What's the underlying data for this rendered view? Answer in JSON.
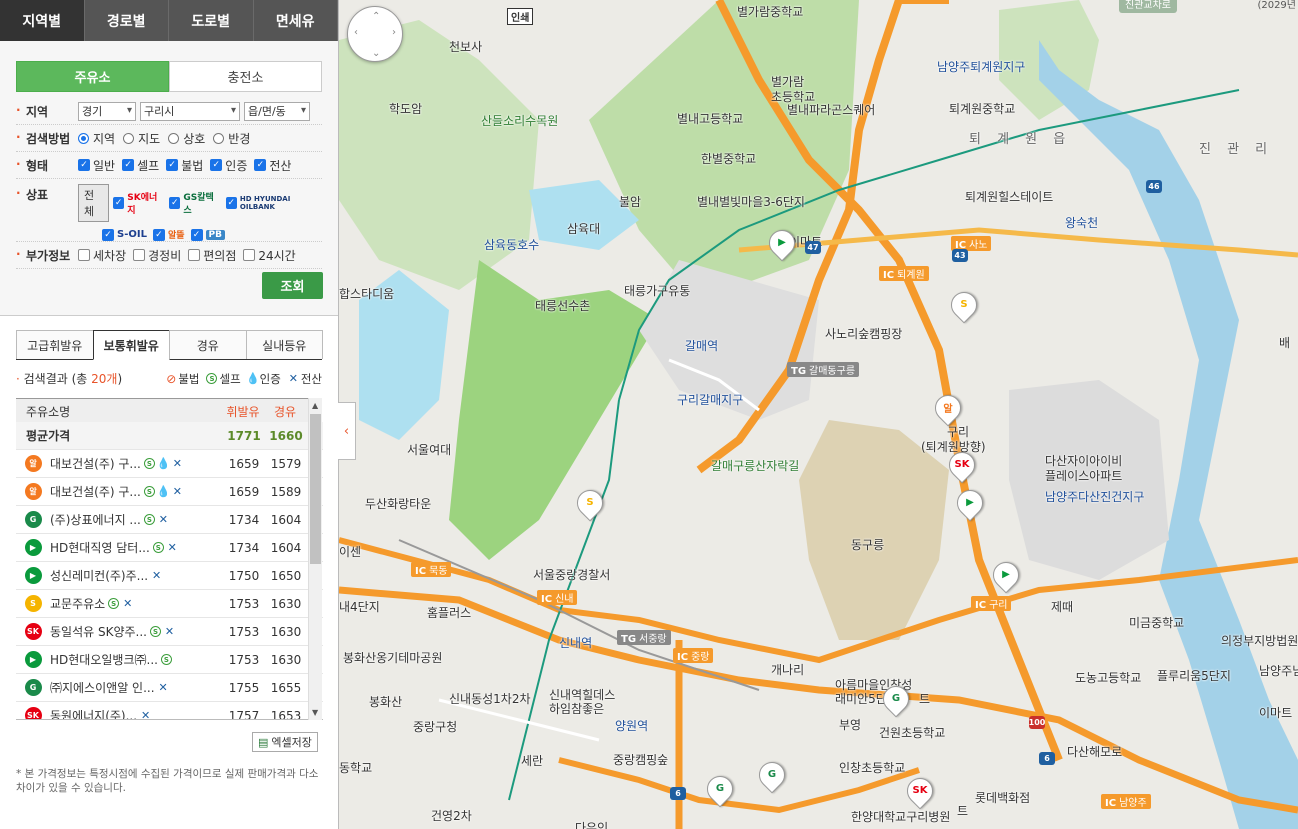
{
  "top_tabs": [
    "지역별",
    "경로별",
    "도로별",
    "면세유"
  ],
  "mode_tabs": [
    "주유소",
    "충전소"
  ],
  "filters": {
    "region_label": "지역",
    "region_sido": "경기",
    "region_sigungu": "구리시",
    "region_dong": "읍/면/동",
    "method_label": "검색방법",
    "methods": [
      "지역",
      "지도",
      "상호",
      "반경"
    ],
    "type_label": "형태",
    "types": [
      "일반",
      "셀프",
      "불법",
      "인증",
      "전산"
    ],
    "brand_label": "상표",
    "brand_all": "전체",
    "brands": [
      "SK에너지",
      "GS칼텍스",
      "HD HYUNDAI OILBANK",
      "S-OIL",
      "알뜰",
      "PB"
    ],
    "extra_label": "부가정보",
    "extras": [
      "세차장",
      "경정비",
      "편의점",
      "24시간"
    ]
  },
  "query_button": "조회",
  "fuel_tabs": [
    "고급휘발유",
    "보통휘발유",
    "경유",
    "실내등유"
  ],
  "result": {
    "prefix": "검색결과 (총 ",
    "count": "20개",
    "suffix": ")"
  },
  "legend": {
    "illegal": "불법",
    "self": "셀프",
    "certified": "인증",
    "network": "전산"
  },
  "table": {
    "headers": [
      "주유소명",
      "휘발유",
      "경유"
    ],
    "avg": {
      "name": "평균가격",
      "gas": "1771",
      "diesel": "1660"
    },
    "rows": [
      {
        "brand": "알뜰",
        "name": "대보건설(주) 구...",
        "gas": "1659",
        "diesel": "1579",
        "badges": [
          "S",
          "drop",
          "x"
        ]
      },
      {
        "brand": "알뜰",
        "name": "대보건설(주) 구...",
        "gas": "1659",
        "diesel": "1589",
        "badges": [
          "S",
          "drop",
          "x"
        ]
      },
      {
        "brand": "GS",
        "name": "(주)상표에너지 ...",
        "gas": "1734",
        "diesel": "1604",
        "badges": [
          "S",
          "x"
        ]
      },
      {
        "brand": "HD",
        "name": "HD현대직영 담터...",
        "gas": "1734",
        "diesel": "1604",
        "badges": [
          "S",
          "x"
        ]
      },
      {
        "brand": "HD",
        "name": "성신레미컨(주)주...",
        "gas": "1750",
        "diesel": "1650",
        "badges": [
          "x"
        ]
      },
      {
        "brand": "S-OIL",
        "name": "교문주유소",
        "gas": "1753",
        "diesel": "1630",
        "badges": [
          "S",
          "x"
        ]
      },
      {
        "brand": "SK",
        "name": "동일석유 SK양주...",
        "gas": "1753",
        "diesel": "1630",
        "badges": [
          "S",
          "x"
        ]
      },
      {
        "brand": "HD",
        "name": "HD현대오일뱅크㈜...",
        "gas": "1753",
        "diesel": "1630",
        "badges": [
          "S"
        ]
      },
      {
        "brand": "GS",
        "name": "㈜지에스이앤알 인...",
        "gas": "1755",
        "diesel": "1655",
        "badges": [
          "x"
        ]
      },
      {
        "brand": "SK",
        "name": "동원에너지(주)...",
        "gas": "1757",
        "diesel": "1653",
        "badges": [
          "x"
        ]
      }
    ]
  },
  "excel_button": "엑셀저장",
  "note": "* 본 가격정보는 특정시점에 수집된 가격이므로 실제 판매가격과 다소 차이가 있을 수 있습니다.",
  "map": {
    "incheon": "인쇄",
    "top_right": "(2029년",
    "top_green": "진관교차로",
    "labels": [
      {
        "t": "별가람중학교",
        "c": ""
      },
      {
        "t": "천보사",
        "c": ""
      },
      {
        "t": "학도암",
        "c": ""
      },
      {
        "t": "산들소리수목원",
        "c": "green"
      },
      {
        "t": "별가람",
        "c": ""
      },
      {
        "t": "초등학교",
        "c": ""
      },
      {
        "t": "별내파라곤스퀘어",
        "c": ""
      },
      {
        "t": "남양주퇴계원지구",
        "c": "blue"
      },
      {
        "t": "퇴계원중학교",
        "c": ""
      },
      {
        "t": "퇴 계 원 읍",
        "c": "big"
      },
      {
        "t": "진 관 리",
        "c": "big"
      },
      {
        "t": "별내고등학교",
        "c": ""
      },
      {
        "t": "한별중학교",
        "c": ""
      },
      {
        "t": "불암",
        "c": ""
      },
      {
        "t": "별내별빛마을3-6단지",
        "c": ""
      },
      {
        "t": "퇴계원힐스테이트",
        "c": ""
      },
      {
        "t": "삼육대",
        "c": ""
      },
      {
        "t": "삼육동호수",
        "c": "blue"
      },
      {
        "t": "왕숙천",
        "c": "blue"
      },
      {
        "t": "이마트",
        "c": ""
      },
      {
        "t": "합스타디움",
        "c": ""
      },
      {
        "t": "태릉가구유통",
        "c": ""
      },
      {
        "t": "태릉선수촌",
        "c": ""
      },
      {
        "t": "사노리숲캠핑장",
        "c": ""
      },
      {
        "t": "갈매역",
        "c": "blue"
      },
      {
        "t": "구리갈매지구",
        "c": "blue"
      },
      {
        "t": "서울여대",
        "c": ""
      },
      {
        "t": "구리",
        "c": ""
      },
      {
        "t": "(퇴계원방향)",
        "c": ""
      },
      {
        "t": "다산자이아이비",
        "c": ""
      },
      {
        "t": "플레이스아파트",
        "c": ""
      },
      {
        "t": "갈매구릉산자락길",
        "c": "green"
      },
      {
        "t": "남양주다산진건지구",
        "c": "blue"
      },
      {
        "t": "두산화랑타운",
        "c": ""
      },
      {
        "t": "동구릉",
        "c": ""
      },
      {
        "t": "이센",
        "c": ""
      },
      {
        "t": "서울중랑경찰서",
        "c": ""
      },
      {
        "t": "홈플러스",
        "c": ""
      },
      {
        "t": "내4단지",
        "c": ""
      },
      {
        "t": "제때",
        "c": ""
      },
      {
        "t": "미금중학교",
        "c": ""
      },
      {
        "t": "의정부지방법원",
        "c": ""
      },
      {
        "t": "봉화산옹기테마공원",
        "c": ""
      },
      {
        "t": "신내역",
        "c": "blue"
      },
      {
        "t": "개나리",
        "c": ""
      },
      {
        "t": "도농고등학교",
        "c": ""
      },
      {
        "t": "플루리움5단지",
        "c": ""
      },
      {
        "t": "남양주님",
        "c": ""
      },
      {
        "t": "봉화산",
        "c": ""
      },
      {
        "t": "신내동성1차2차",
        "c": ""
      },
      {
        "t": "신내역힐데스",
        "c": ""
      },
      {
        "t": "하임참좋은",
        "c": ""
      },
      {
        "t": "아름마을인창성",
        "c": ""
      },
      {
        "t": "래미안5단지",
        "c": ""
      },
      {
        "t": "트",
        "c": ""
      },
      {
        "t": "부영",
        "c": ""
      },
      {
        "t": "건원초등학교",
        "c": ""
      },
      {
        "t": "이마트",
        "c": ""
      },
      {
        "t": "중랑구청",
        "c": ""
      },
      {
        "t": "양원역",
        "c": "blue"
      },
      {
        "t": "다산해모로",
        "c": ""
      },
      {
        "t": "동학교",
        "c": ""
      },
      {
        "t": "세란",
        "c": ""
      },
      {
        "t": "중랑캠핑숲",
        "c": ""
      },
      {
        "t": "인창초등학교",
        "c": ""
      },
      {
        "t": "롯데백화점",
        "c": ""
      },
      {
        "t": "건영2차",
        "c": ""
      },
      {
        "t": "한양대학교구리병원",
        "c": ""
      },
      {
        "t": "다우인",
        "c": ""
      },
      {
        "t": "트",
        "c": ""
      },
      {
        "t": "배",
        "c": ""
      }
    ],
    "ic": [
      {
        "t": "사노"
      },
      {
        "t": "퇴계원"
      },
      {
        "t": "구리"
      },
      {
        "t": "묵동"
      },
      {
        "t": "신내"
      },
      {
        "t": "중랑"
      },
      {
        "t": "남양주"
      }
    ],
    "tg": [
      {
        "t": "갈매동구릉"
      },
      {
        "t": "서중랑"
      }
    ]
  },
  "colors": {
    "accent": "#5cb85c",
    "orange": "#e8542a",
    "highway": "#f59a2c"
  }
}
